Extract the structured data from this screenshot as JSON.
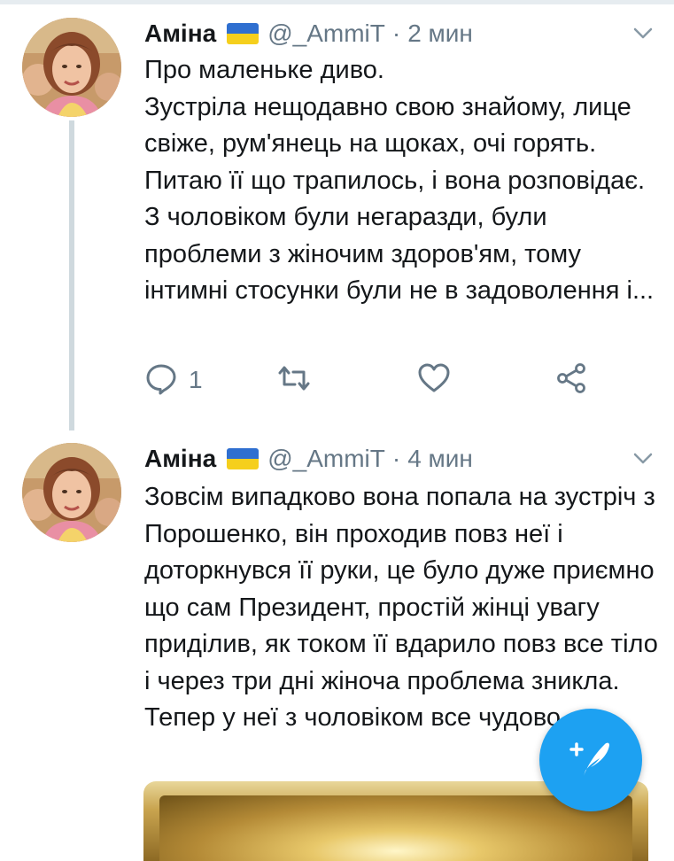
{
  "tweets": [
    {
      "author": "Аміна",
      "handle": "@_AmmiT",
      "separator": "·",
      "time": "2 мин",
      "text": "Про маленьке диво.\nЗустріла нещодавно свою знайому, лице свіже, рум'янець на щоках, очі горять. Питаю її що трапилось, і вона розповідає. З чоловіком були негаразди, були проблеми з жіночим здоров'ям, тому інтимні стосунки були не в задоволення і...",
      "reply_count": "1"
    },
    {
      "author": "Аміна",
      "handle": "@_AmmiT",
      "separator": "·",
      "time": "4 мин",
      "text": "Зовсім випадково вона попала на зустріч з Порошенко, він проходив повз неї і доторкнувся її руки, це було дуже приємно що сам Президент, простій жінці увагу приділив, як током її вдарило повз все тіло і через три дні жіноча проблема зникла. Тепер у неї з чоловіком все чудово."
    }
  ],
  "icons": {
    "flag": "ukraine-flag-icon",
    "caret": "chevron-down-icon",
    "reply": "reply-icon",
    "retweet": "retweet-icon",
    "like": "heart-icon",
    "share": "share-icon",
    "compose": "compose-tweet-icon"
  },
  "colors": {
    "accent": "#1da1f2",
    "secondary_text": "#657786",
    "thread_line": "#cfd9de",
    "flag_blue": "#2f6fd0",
    "flag_yellow": "#f5cf1d"
  }
}
